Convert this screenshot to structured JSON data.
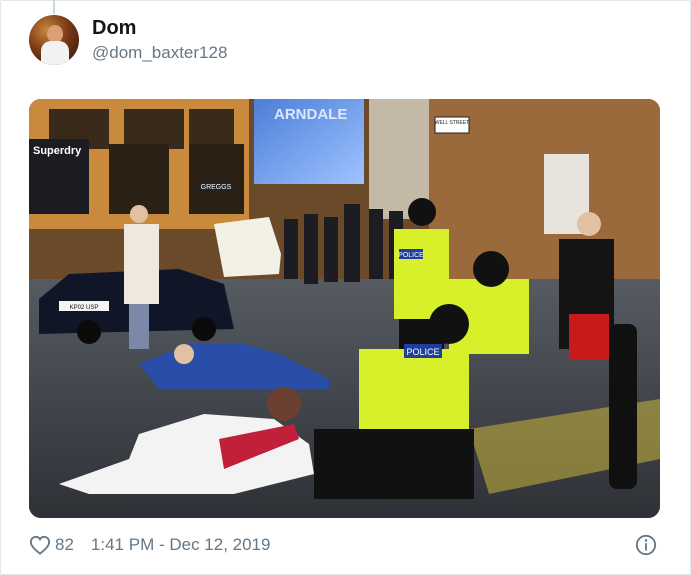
{
  "tweet": {
    "display_name": "Dom",
    "handle": "@dom_baxter128",
    "like_count": "82",
    "timestamp": "1:41 PM - Dec 12, 2019"
  },
  "media": {
    "shop_sign_left": "Superdry",
    "shop_sign_center": "ARNDALE",
    "shop_sign_greggs": "GREGGS",
    "street_sign": "WELL STREET",
    "police_vest_1": "POLICE",
    "police_vest_2": "POLICE",
    "number_plate": "KP02 USP"
  },
  "icons": {
    "like": "heart-outline-icon",
    "info": "info-circle-icon"
  }
}
